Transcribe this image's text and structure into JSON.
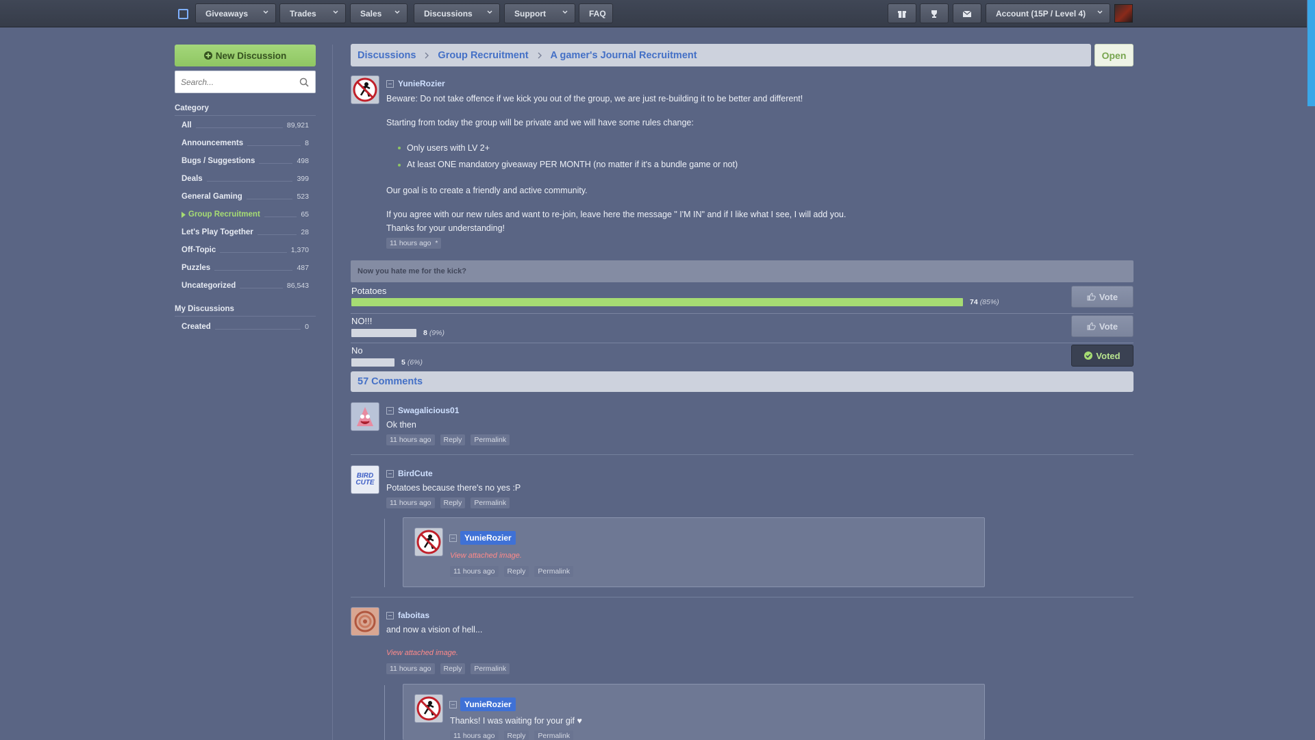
{
  "nav": {
    "giveaways": "Giveaways",
    "trades": "Trades",
    "sales": "Sales",
    "discussions": "Discussions",
    "support": "Support",
    "faq": "FAQ",
    "account": "Account (15P / Level 4)",
    "icons": [
      "gift-icon",
      "trophy-icon",
      "mail-icon"
    ]
  },
  "sidebar": {
    "new_discussion": "New Discussion",
    "search_placeholder": "Search...",
    "category_heading": "Category",
    "categories": [
      {
        "label": "All",
        "count": "89,921"
      },
      {
        "label": "Announcements",
        "count": "8"
      },
      {
        "label": "Bugs / Suggestions",
        "count": "498"
      },
      {
        "label": "Deals",
        "count": "399"
      },
      {
        "label": "General Gaming",
        "count": "523"
      },
      {
        "label": "Group Recruitment",
        "count": "65"
      },
      {
        "label": "Let's Play Together",
        "count": "28"
      },
      {
        "label": "Off-Topic",
        "count": "1,370"
      },
      {
        "label": "Puzzles",
        "count": "487"
      },
      {
        "label": "Uncategorized",
        "count": "86,543"
      }
    ],
    "my_heading": "My Discussions",
    "my_items": [
      {
        "label": "Created",
        "count": "0"
      }
    ]
  },
  "breadcrumb": {
    "items": [
      "Discussions",
      "Group Recruitment",
      "A gamer's Journal Recruitment"
    ],
    "status": "Open"
  },
  "post": {
    "author": "YunieRozier",
    "line1": "Beware: Do not take offence if we kick you out of the group, we are just re-building it to be better and different!",
    "line2": "Starting from today the group will be private and we will have some rules change:",
    "bullet1": "Only users with LV 2+",
    "bullet2": "At least ONE mandatory giveaway PER MONTH (no matter if it's a bundle game or not)",
    "line3": "Our goal is to create a friendly and active community.",
    "line4": "If you agree with our new rules and want to re-join, leave here the message \" I'M IN\" and if I like what I see, I will add you.",
    "line5": "Thanks for your understanding!",
    "time": "11 hours ago",
    "edited": "*"
  },
  "poll": {
    "question": "Now you hate me for the kick?",
    "options": [
      {
        "label": "Potatoes",
        "votes": "74",
        "pct": "(85%)",
        "fraction": 0.85,
        "button": "Vote"
      },
      {
        "label": "NO!!!",
        "votes": "8",
        "pct": "(9%)",
        "fraction": 0.09,
        "button": "Vote"
      },
      {
        "label": "No",
        "votes": "5",
        "pct": "(6%)",
        "fraction": 0.06,
        "button": "Voted"
      }
    ],
    "bar_color": "#a6dc73",
    "bar_color_other": "#d3d7e0"
  },
  "comments": {
    "heading": "57 Comments",
    "reply": "Reply",
    "permalink": "Permalink",
    "items": [
      {
        "author": "Swagalicious01",
        "text": "Ok then",
        "time": "11 hours ago"
      },
      {
        "author": "BirdCute",
        "text": "Potatoes because there's no yes :P",
        "time": "11 hours ago",
        "avatar_text": "BIRD CUTE"
      },
      {
        "author": "YunieRozier",
        "text": "View attached image.",
        "time": "11 hours ago"
      },
      {
        "author": "faboitas",
        "text": "and now a vision of hell...",
        "attached": "View attached image.",
        "time": "11 hours ago"
      },
      {
        "author": "YunieRozier",
        "text": "Thanks! I was waiting for your gif ♥",
        "time": "11 hours ago"
      }
    ]
  }
}
